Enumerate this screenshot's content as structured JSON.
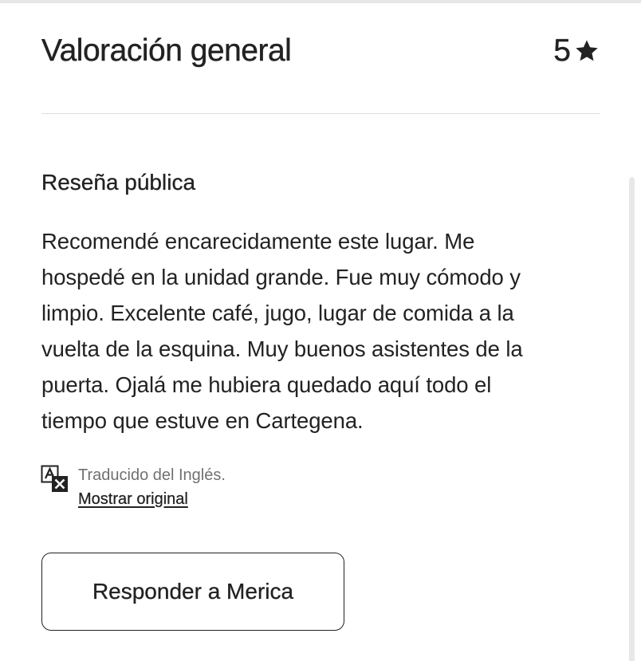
{
  "rating": {
    "title": "Valoración general",
    "value": "5",
    "icon": "star-icon"
  },
  "review": {
    "section_title": "Reseña pública",
    "lines": [
      "Recomendé encarecidamente este lugar. Me",
      "hospedé en la unidad grande. Fue muy cómodo y",
      "limpio. Excelente café, jugo, lugar de comida a la",
      "vuelta de la esquina. Muy buenos asistentes de la",
      "puerta. Ojalá me hubiera quedado aquí todo el",
      "tiempo que estuve en Cartegena."
    ]
  },
  "translation": {
    "icon": "translate-icon",
    "note": "Traducido del Inglés.",
    "show_original_label": "Mostrar original"
  },
  "actions": {
    "reply_label": "Responder a Merica"
  },
  "colors": {
    "text": "#222222",
    "muted": "#717171",
    "divider": "#dddddd"
  }
}
